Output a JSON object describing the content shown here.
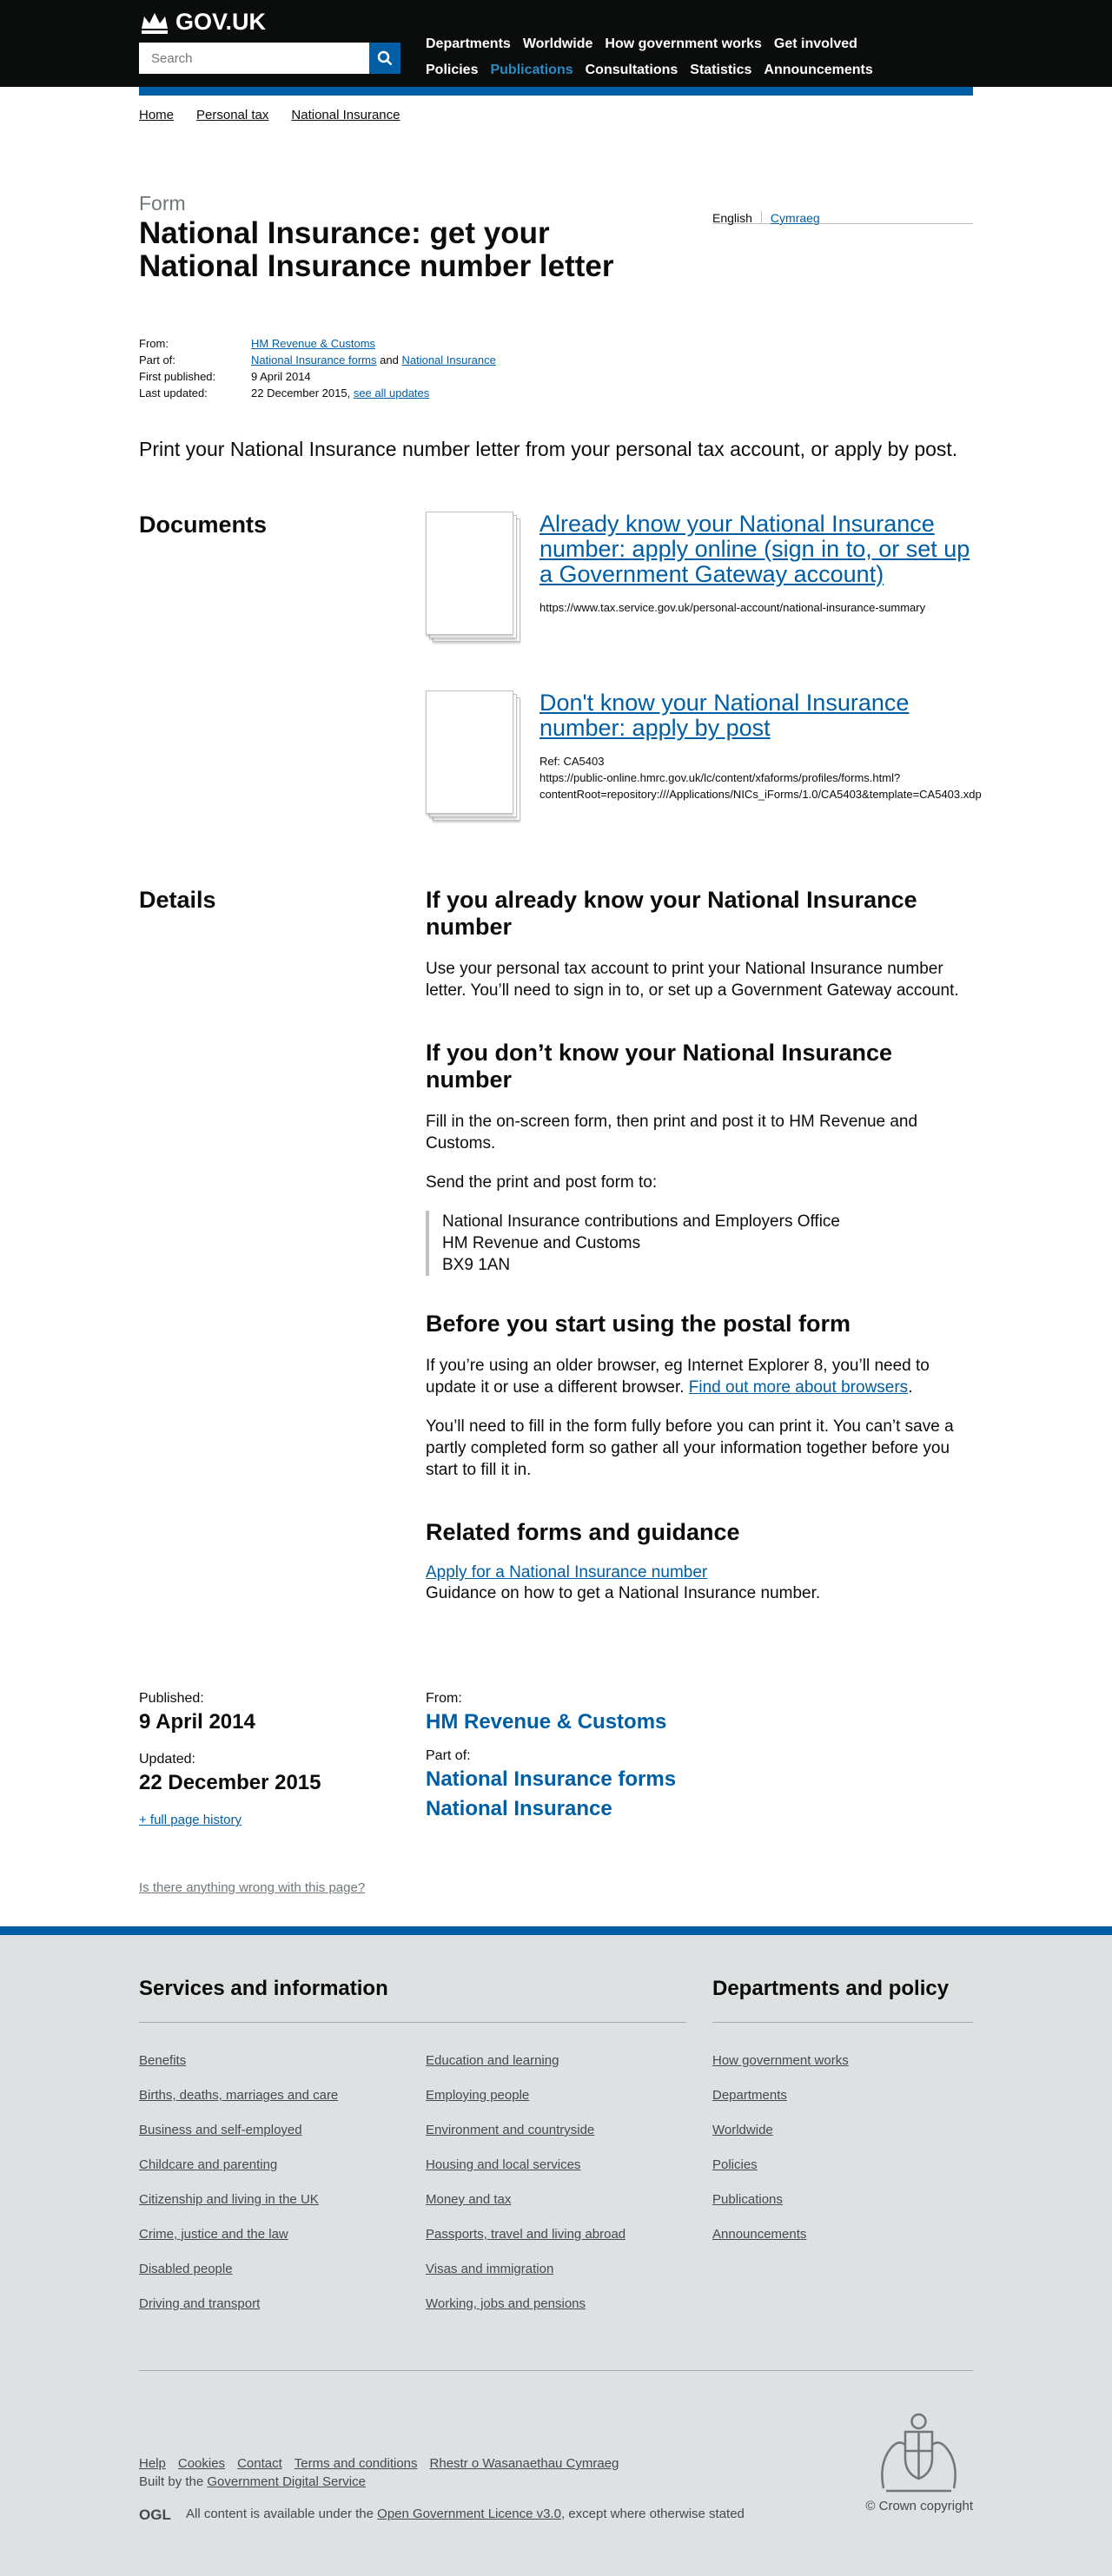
{
  "header": {
    "logo_text": "GOV.UK",
    "search_placeholder": "Search",
    "nav_row1": [
      "Departments",
      "Worldwide",
      "How government works",
      "Get involved"
    ],
    "nav_row2": [
      "Policies",
      "Publications",
      "Consultations",
      "Statistics",
      "Announcements"
    ],
    "active_item": "Publications"
  },
  "breadcrumbs": [
    "Home",
    "Personal tax",
    "National Insurance"
  ],
  "page": {
    "type": "Form",
    "title": "National Insurance: get your National Insurance number letter",
    "languages": {
      "current": "English",
      "other": "Cymraeg"
    },
    "meta": {
      "from_label": "From:",
      "from_value": "HM Revenue & Customs",
      "part_of_label": "Part of:",
      "part_of_1": "National Insurance forms",
      "part_of_and": "and",
      "part_of_2": "National Insurance",
      "first_published_label": "First published:",
      "first_published_value": "9 April 2014",
      "last_updated_label": "Last updated:",
      "last_updated_value": "22 December 2015,",
      "see_all_updates": "see all updates"
    },
    "lead": "Print your National Insurance number letter from your personal tax account, or apply by post."
  },
  "documents": {
    "heading": "Documents",
    "items": [
      {
        "title": "Already know your National Insurance number: apply online (sign in to, or set up a Government Gateway account)",
        "ref": "",
        "url": "https://www.tax.service.gov.uk/personal-account/national-insurance-summary"
      },
      {
        "title": "Don't know your National Insurance number: apply by post",
        "ref": "Ref: CA5403",
        "url": "https://public-online.hmrc.gov.uk/lc/content/xfaforms/profiles/forms.html?contentRoot=repository:///Applications/NICs_iForms/1.0/CA5403&template=CA5403.xdp"
      }
    ]
  },
  "details": {
    "heading": "Details",
    "h_know": "If you already know your National Insurance number",
    "p_know": "Use your personal tax account to print your National Insurance number letter. You’ll need to sign in to, or set up a Government Gateway account.",
    "h_dont": "If you don’t know your National Insurance number",
    "p_dont1": "Fill in the on-screen form, then print and post it to HM Revenue and Customs.",
    "p_dont2": "Send the print and post form to:",
    "address": [
      "National Insurance contributions and Employers Office",
      "HM Revenue and Customs",
      "BX9 1AN"
    ],
    "h_before": "Before you start using the postal form",
    "p_before1": "If you’re using an older browser, eg Internet Explorer 8, you’ll need to update it or use a different browser.",
    "p_before1_link": "Find out more about browsers",
    "p_before2": "You’ll need to fill in the form fully before you can print it. You can’t save a partly completed form so gather all your information together before you start to fill it in.",
    "h_related": "Related forms and guidance",
    "related_link": "Apply for a National Insurance number",
    "related_desc": "Guidance on how to get a National Insurance number."
  },
  "footer_meta": {
    "published_label": "Published:",
    "published_value": "9 April 2014",
    "updated_label": "Updated:",
    "updated_value": "22 December 2015",
    "history_link": "+ full page history",
    "from_label": "From:",
    "from_value": "HM Revenue & Customs",
    "part_of_label": "Part of:",
    "part_of_1": "National Insurance forms",
    "part_of_2": "National Insurance"
  },
  "report_link": "Is there anything wrong with this page?",
  "footer": {
    "services_heading": "Services and information",
    "services_col1": [
      "Benefits",
      "Births, deaths, marriages and care",
      "Business and self-employed",
      "Childcare and parenting",
      "Citizenship and living in the UK",
      "Crime, justice and the law",
      "Disabled people",
      "Driving and transport"
    ],
    "services_col2": [
      "Education and learning",
      "Employing people",
      "Environment and countryside",
      "Housing and local services",
      "Money and tax",
      "Passports, travel and living abroad",
      "Visas and immigration",
      "Working, jobs and pensions"
    ],
    "departments_heading": "Departments and policy",
    "departments": [
      "How government works",
      "Departments",
      "Worldwide",
      "Policies",
      "Publications",
      "Announcements"
    ],
    "bottom_links": [
      "Help",
      "Cookies",
      "Contact",
      "Terms and conditions",
      "Rhestr o Wasanaethau Cymraeg"
    ],
    "built_prefix": "Built by the",
    "built_link": "Government Digital Service",
    "ogl_logo": "OGL",
    "licence_prefix": "All content is available under the",
    "licence_link": "Open Government Licence v3.0",
    "licence_suffix": ", except where otherwise stated",
    "copyright": "© Crown copyright"
  },
  "colors": {
    "brand_blue": "#005ea5",
    "header_black": "#0b0c0c",
    "footer_grey": "#dee0e2",
    "active_nav": "#2b8cc4"
  }
}
